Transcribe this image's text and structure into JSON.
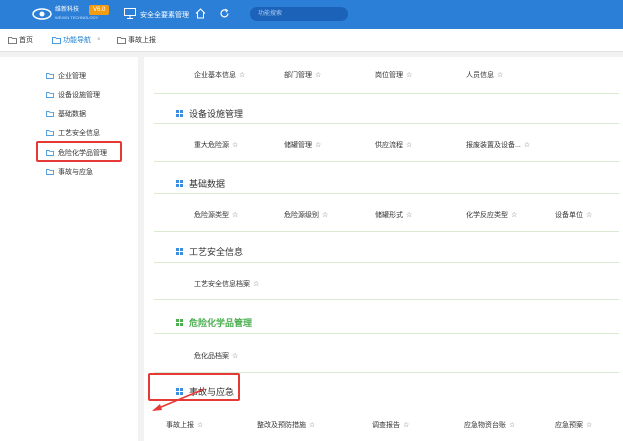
{
  "header": {
    "brand": "维新科技",
    "brand_sub": "WEIXIN TECHNOLOGY",
    "version": "V6.0",
    "system_title": "安全全要素管理",
    "search_placeholder": "功能搜索",
    "brand_color": "#2c7fd6"
  },
  "tabs": [
    {
      "label": "首页"
    },
    {
      "label": "功能导航",
      "close": "×"
    },
    {
      "label": "事故上报"
    }
  ],
  "sidebar": {
    "items": [
      {
        "label": "企业管理"
      },
      {
        "label": "设备设施管理"
      },
      {
        "label": "基础数据"
      },
      {
        "label": "工艺安全信息"
      },
      {
        "label": "危险化学品管理"
      },
      {
        "label": "事故与应急"
      }
    ]
  },
  "star": "☆",
  "main": {
    "sections": [
      {
        "title": null,
        "links": [
          "企业基本信息",
          "部门管理",
          "岗位管理",
          "人员信息"
        ]
      },
      {
        "title": "设备设施管理",
        "links": [
          "重大危险源",
          "储罐管理",
          "供应流程",
          "报废装置及设备..."
        ]
      },
      {
        "title": "基础数据",
        "links": [
          "危险源类型",
          "危险源级别",
          "储罐形式",
          "化学反应类型",
          "设备单位"
        ]
      },
      {
        "title": "工艺安全信息",
        "links": [
          "工艺安全信息档案"
        ]
      },
      {
        "title": "危险化学品管理",
        "links": [
          "危化品档案"
        ]
      },
      {
        "title": "事故与应急",
        "links": [
          "事故上报",
          "整改及预防措施",
          "调查报告",
          "应急物资台账",
          "应急预案"
        ]
      }
    ]
  }
}
